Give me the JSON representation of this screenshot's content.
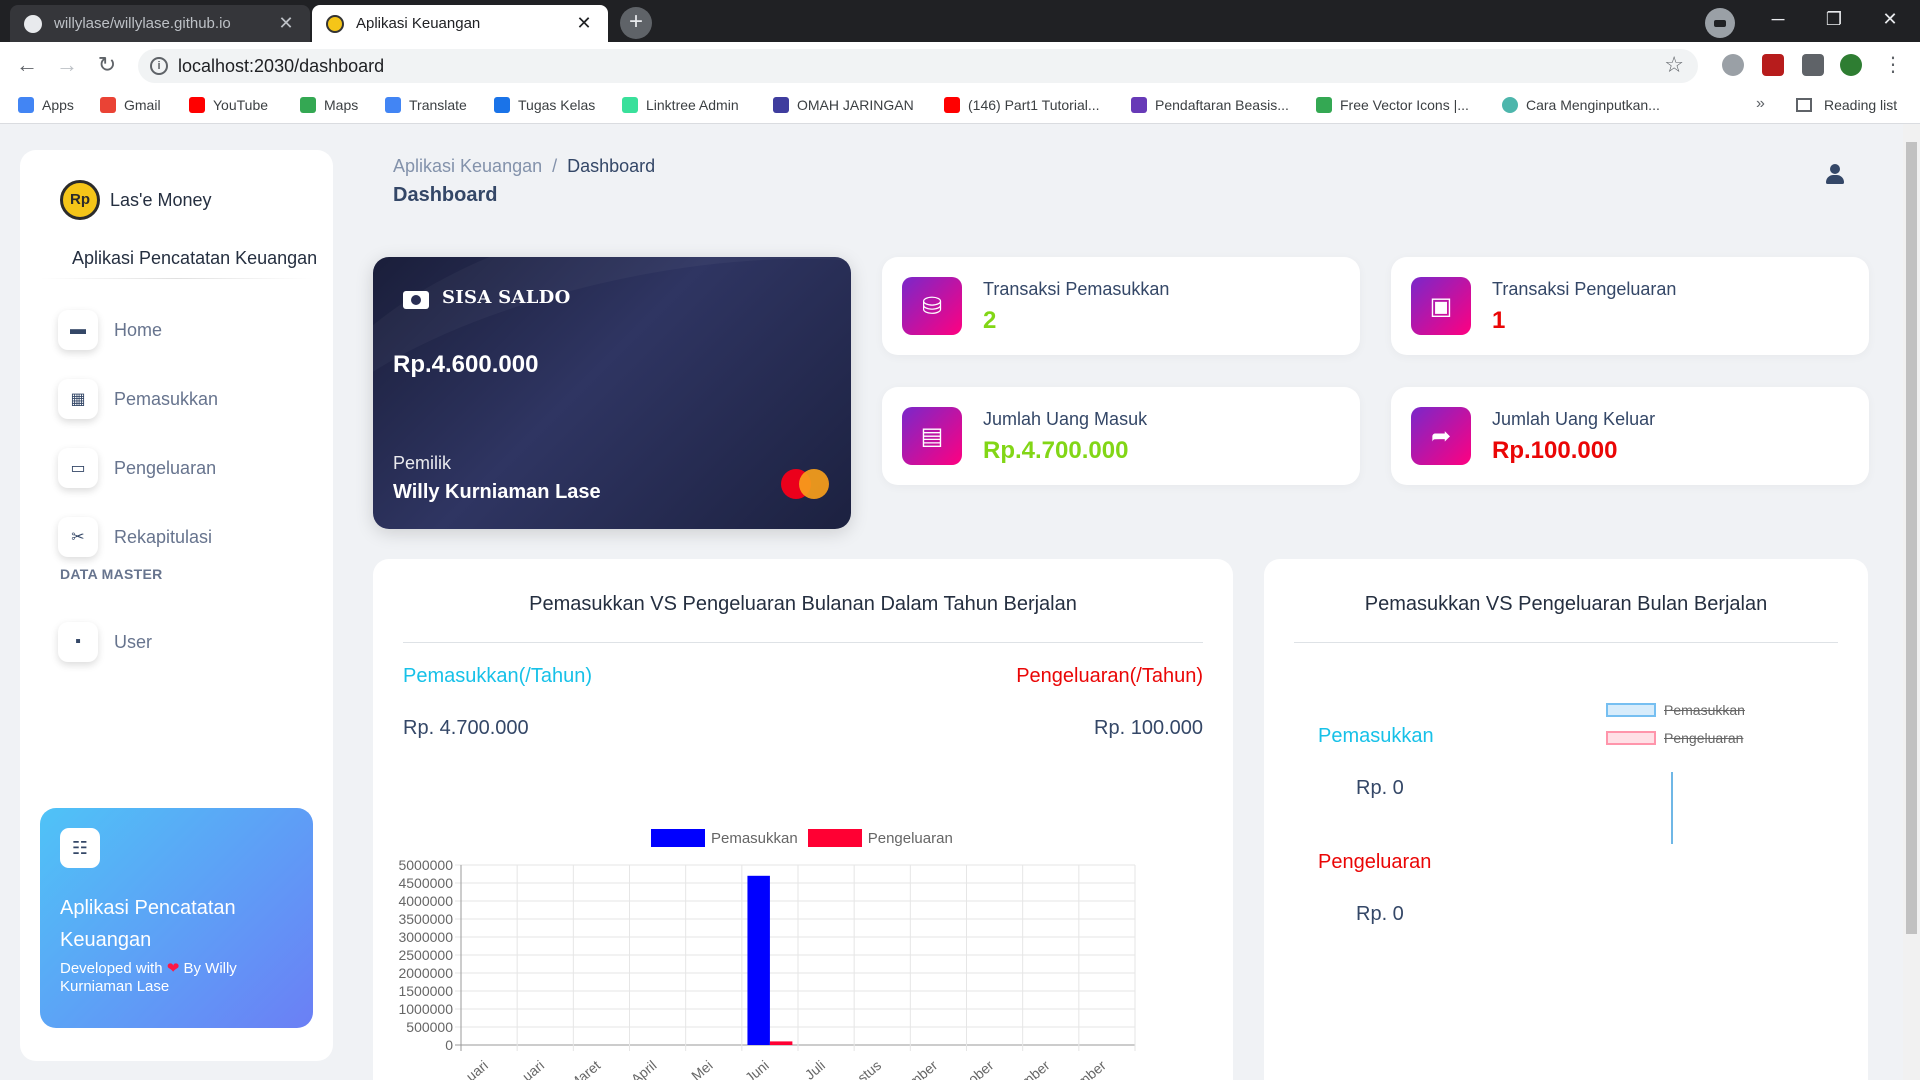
{
  "browser": {
    "tabs": [
      {
        "title": "willylase/willylase.github.io",
        "close": "✕"
      },
      {
        "title": "Aplikasi Keuangan",
        "close": "✕"
      }
    ],
    "new_tab": "+",
    "url": "localhost:2030/dashboard",
    "bookmarks": [
      {
        "label": "Apps",
        "icon": "apps-grid-icon",
        "color": "#4285f4"
      },
      {
        "label": "Gmail",
        "icon": "gmail-icon",
        "color": "#ea4335"
      },
      {
        "label": "YouTube",
        "icon": "youtube-icon",
        "color": "#ff0000"
      },
      {
        "label": "Maps",
        "icon": "maps-icon",
        "color": "#34a853"
      },
      {
        "label": "Translate",
        "icon": "translate-icon",
        "color": "#4285f4"
      },
      {
        "label": "Tugas Kelas",
        "icon": "classroom-icon",
        "color": "#1a73e8"
      },
      {
        "label": "Linktree Admin",
        "icon": "linktree-icon",
        "color": "#39e09b"
      },
      {
        "label": "OMAH JARINGAN",
        "icon": "omah-icon",
        "color": "#3f3d9e"
      },
      {
        "label": "(146) Part1 Tutorial...",
        "icon": "youtube-icon",
        "color": "#ff0000"
      },
      {
        "label": "Pendaftaran Beasis...",
        "icon": "forms-icon",
        "color": "#673ab7"
      },
      {
        "label": "Free Vector Icons |...",
        "icon": "vector-icon",
        "color": "#34a853"
      },
      {
        "label": "Cara Menginputkan...",
        "icon": "globe-icon",
        "color": "#4db6ac"
      }
    ],
    "more_bookmarks": "»",
    "reading_list": "Reading list"
  },
  "sidebar": {
    "brand_name": "Las'e Money",
    "brand_logo_text": "Rp",
    "brand_subtitle": "Aplikasi Pencatatan Keuangan",
    "items": [
      {
        "label": "Home",
        "icon": "store-icon"
      },
      {
        "label": "Pemasukkan",
        "icon": "building-icon"
      },
      {
        "label": "Pengeluaran",
        "icon": "credit-card-icon"
      },
      {
        "label": "Rekapitulasi",
        "icon": "tools-icon"
      }
    ],
    "section_title": "DATA MASTER",
    "master_items": [
      {
        "label": "User",
        "icon": "user-card-icon"
      }
    ],
    "help_card": {
      "title": "Aplikasi Pencatatan Keuangan",
      "dev_prefix": "Developed with",
      "dev_suffix": "By Willy Kurniaman Lase"
    }
  },
  "header": {
    "breadcrumb_root": "Aplikasi Keuangan",
    "breadcrumb_sep": "/",
    "breadcrumb_current": "Dashboard",
    "title": "Dashboard"
  },
  "balance_card": {
    "label": "SISA SALDO",
    "amount": "Rp.4.600.000",
    "owner_label": "Pemilik",
    "owner_name": "Willy Kurniaman Lase"
  },
  "stats": [
    {
      "label": "Transaksi Pemasukkan",
      "value": "2",
      "icon": "money-stack-icon",
      "color": "#82d616"
    },
    {
      "label": "Transaksi Pengeluaran",
      "value": "1",
      "icon": "money-bill-icon",
      "color": "#ea0606"
    },
    {
      "label": "Jumlah Uang Masuk",
      "value": "Rp.4.700.000",
      "icon": "money-check-icon",
      "color": "#82d616"
    },
    {
      "label": "Jumlah Uang Keluar",
      "value": "Rp.100.000",
      "icon": "share-arrow-icon",
      "color": "#ea0606"
    }
  ],
  "yearly_panel": {
    "title": "Pemasukkan VS Pengeluaran Bulanan Dalam Tahun Berjalan",
    "income_label": "Pemasukkan(/Tahun)",
    "income_amount": "Rp. 4.700.000",
    "expense_label": "Pengeluaran(/Tahun)",
    "expense_amount": "Rp. 100.000"
  },
  "monthly_panel": {
    "title": "Pemasukkan VS Pengeluaran Bulan Berjalan",
    "income_label": "Pemasukkan",
    "income_amount": "Rp. 0",
    "expense_label": "Pengeluaran",
    "expense_amount": "Rp. 0",
    "legend": [
      "Pemasukkan",
      "Pengeluaran"
    ]
  },
  "chart_data": {
    "type": "bar",
    "categories": [
      "Januari",
      "Februari",
      "Maret",
      "April",
      "Mei",
      "Juni",
      "Juli",
      "Agustus",
      "September",
      "Oktober",
      "November",
      "Desember"
    ],
    "visible_tick_labels": [
      "uari",
      "uari",
      "Maret",
      "April",
      "Mei",
      "Juni",
      "Juli",
      "stus",
      "mber",
      "ober",
      "mber",
      "mber"
    ],
    "series": [
      {
        "name": "Pemasukkan",
        "color": "#0000ff",
        "values": [
          0,
          0,
          0,
          0,
          0,
          4700000,
          0,
          0,
          0,
          0,
          0,
          0
        ]
      },
      {
        "name": "Pengeluaran",
        "color": "#ff0033",
        "values": [
          0,
          0,
          0,
          0,
          0,
          100000,
          0,
          0,
          0,
          0,
          0,
          0
        ]
      }
    ],
    "ylim": [
      0,
      5000000
    ],
    "yticks": [
      "5000000",
      "4500000",
      "4000000",
      "3500000",
      "3000000",
      "2500000",
      "2000000",
      "1500000",
      "1000000",
      "500000",
      "0"
    ],
    "grid": true,
    "legend_position": "top-center"
  }
}
